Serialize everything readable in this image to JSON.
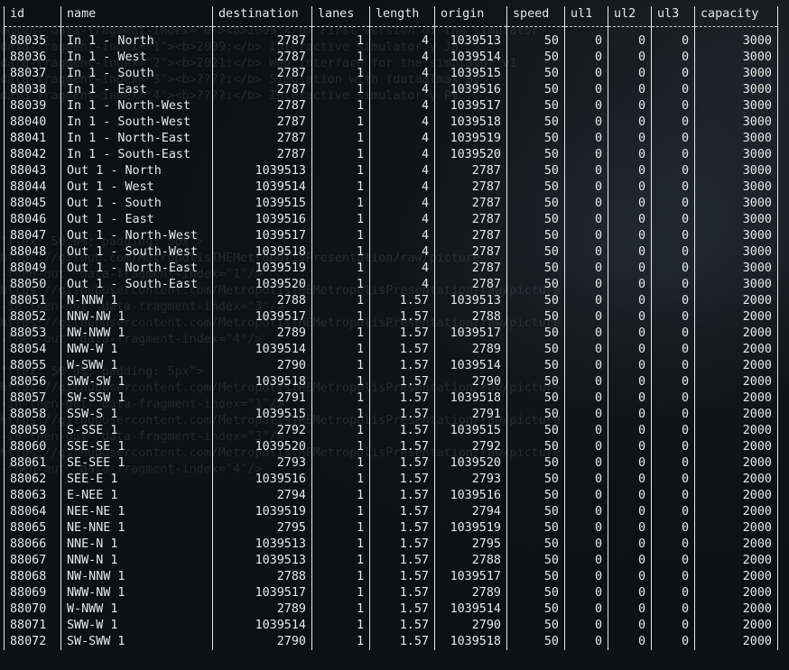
{
  "ghost_lines": [
    "agment data-fragment-index=\"0\"><b>2009:</b> First version of the simulator",
    "data-fragment-index=\"1\"><b>2009:</b> Interactive simulator y Ja",
    "data-fragment-index=\"2\"><b>2021:</b> Web interface for the simulator v1",
    "data-fragment-index=\"3\"><b>????:</b> Simulation with (dataalmax av",
    "data-fragment-index=\"4\"><b>????:</b> Interactive simulator y Py",
    "",
    "",
    "",
    "",
    "",
    "",
    "",
    "",
    "\"flex: 50.0%; padding: 5px\">",
    "https://github.com/MetropolisTHEMetropolisPresentation/raw/picture",
    "-then-out\" data-fragment-index=\"1\"/>",
    "https://githubusercontent.com/MetropolisTHEMetropolisPresentation/raw/picture",
    "-in-then-out\" data-fragment-index=\"3\"/>",
    "https://githubusercontent.com/MetropolisTHEMetropolisPresentation/raw/picture",
    "-then-out\" data-fragment-index=\"4\"/>",
    "",
    "\"flex: 50.0%; padding: 5px\">",
    "https://githubusercontent.com/MetropolisTHEMetropolisPresentation/raw/picture",
    "-in-then-out\" data-fragment-index=\"1\"/>",
    "https://githubusercontent.com/MetropolisTHEMetropolisPresentation/raw/picture",
    "-in-then-out\" data-fragment-index=\"3\"/>",
    "https://githubusercontent.com/MetropolisTHEMetropolisPresentation/raw/picture",
    "-then-out\" data-fragment-index=\"4\"/>"
  ],
  "table": {
    "columns": [
      "id",
      "name",
      "destination",
      "lanes",
      "length",
      "origin",
      "speed",
      "ul1",
      "ul2",
      "ul3",
      "capacity"
    ],
    "rows": [
      [
        "88035",
        "In 1 - North",
        "2787",
        "1",
        "4",
        "1039513",
        "50",
        "0",
        "0",
        "0",
        "3000"
      ],
      [
        "88036",
        "In 1 - West",
        "2787",
        "1",
        "4",
        "1039514",
        "50",
        "0",
        "0",
        "0",
        "3000"
      ],
      [
        "88037",
        "In 1 - South",
        "2787",
        "1",
        "4",
        "1039515",
        "50",
        "0",
        "0",
        "0",
        "3000"
      ],
      [
        "88038",
        "In 1 - East",
        "2787",
        "1",
        "4",
        "1039516",
        "50",
        "0",
        "0",
        "0",
        "3000"
      ],
      [
        "88039",
        "In 1 - North-West",
        "2787",
        "1",
        "4",
        "1039517",
        "50",
        "0",
        "0",
        "0",
        "3000"
      ],
      [
        "88040",
        "In 1 - South-West",
        "2787",
        "1",
        "4",
        "1039518",
        "50",
        "0",
        "0",
        "0",
        "3000"
      ],
      [
        "88041",
        "In 1 - North-East",
        "2787",
        "1",
        "4",
        "1039519",
        "50",
        "0",
        "0",
        "0",
        "3000"
      ],
      [
        "88042",
        "In 1 - South-East",
        "2787",
        "1",
        "4",
        "1039520",
        "50",
        "0",
        "0",
        "0",
        "3000"
      ],
      [
        "88043",
        "Out 1 - North",
        "1039513",
        "1",
        "4",
        "2787",
        "50",
        "0",
        "0",
        "0",
        "3000"
      ],
      [
        "88044",
        "Out 1 - West",
        "1039514",
        "1",
        "4",
        "2787",
        "50",
        "0",
        "0",
        "0",
        "3000"
      ],
      [
        "88045",
        "Out 1 - South",
        "1039515",
        "1",
        "4",
        "2787",
        "50",
        "0",
        "0",
        "0",
        "3000"
      ],
      [
        "88046",
        "Out 1 - East",
        "1039516",
        "1",
        "4",
        "2787",
        "50",
        "0",
        "0",
        "0",
        "3000"
      ],
      [
        "88047",
        "Out 1 - North-West",
        "1039517",
        "1",
        "4",
        "2787",
        "50",
        "0",
        "0",
        "0",
        "3000"
      ],
      [
        "88048",
        "Out 1 - South-West",
        "1039518",
        "1",
        "4",
        "2787",
        "50",
        "0",
        "0",
        "0",
        "3000"
      ],
      [
        "88049",
        "Out 1 - North-East",
        "1039519",
        "1",
        "4",
        "2787",
        "50",
        "0",
        "0",
        "0",
        "3000"
      ],
      [
        "88050",
        "Out 1 - South-East",
        "1039520",
        "1",
        "4",
        "2787",
        "50",
        "0",
        "0",
        "0",
        "3000"
      ],
      [
        "88051",
        "N-NNW 1",
        "2788",
        "1",
        "1.57",
        "1039513",
        "50",
        "0",
        "0",
        "0",
        "2000"
      ],
      [
        "88052",
        "NNW-NW 1",
        "1039517",
        "1",
        "1.57",
        "2788",
        "50",
        "0",
        "0",
        "0",
        "2000"
      ],
      [
        "88053",
        "NW-NWW 1",
        "2789",
        "1",
        "1.57",
        "1039517",
        "50",
        "0",
        "0",
        "0",
        "2000"
      ],
      [
        "88054",
        "NWW-W 1",
        "1039514",
        "1",
        "1.57",
        "2789",
        "50",
        "0",
        "0",
        "0",
        "2000"
      ],
      [
        "88055",
        "W-SWW 1",
        "2790",
        "1",
        "1.57",
        "1039514",
        "50",
        "0",
        "0",
        "0",
        "2000"
      ],
      [
        "88056",
        "SWW-SW 1",
        "1039518",
        "1",
        "1.57",
        "2790",
        "50",
        "0",
        "0",
        "0",
        "2000"
      ],
      [
        "88057",
        "SW-SSW 1",
        "2791",
        "1",
        "1.57",
        "1039518",
        "50",
        "0",
        "0",
        "0",
        "2000"
      ],
      [
        "88058",
        "SSW-S 1",
        "1039515",
        "1",
        "1.57",
        "2791",
        "50",
        "0",
        "0",
        "0",
        "2000"
      ],
      [
        "88059",
        "S-SSE 1",
        "2792",
        "1",
        "1.57",
        "1039515",
        "50",
        "0",
        "0",
        "0",
        "2000"
      ],
      [
        "88060",
        "SSE-SE 1",
        "1039520",
        "1",
        "1.57",
        "2792",
        "50",
        "0",
        "0",
        "0",
        "2000"
      ],
      [
        "88061",
        "SE-SEE 1",
        "2793",
        "1",
        "1.57",
        "1039520",
        "50",
        "0",
        "0",
        "0",
        "2000"
      ],
      [
        "88062",
        "SEE-E 1",
        "1039516",
        "1",
        "1.57",
        "2793",
        "50",
        "0",
        "0",
        "0",
        "2000"
      ],
      [
        "88063",
        "E-NEE 1",
        "2794",
        "1",
        "1.57",
        "1039516",
        "50",
        "0",
        "0",
        "0",
        "2000"
      ],
      [
        "88064",
        "NEE-NE 1",
        "1039519",
        "1",
        "1.57",
        "2794",
        "50",
        "0",
        "0",
        "0",
        "2000"
      ],
      [
        "88065",
        "NE-NNE 1",
        "2795",
        "1",
        "1.57",
        "1039519",
        "50",
        "0",
        "0",
        "0",
        "2000"
      ],
      [
        "88066",
        "NNE-N 1",
        "1039513",
        "1",
        "1.57",
        "2795",
        "50",
        "0",
        "0",
        "0",
        "2000"
      ],
      [
        "88067",
        "NNW-N 1",
        "1039513",
        "1",
        "1.57",
        "2788",
        "50",
        "0",
        "0",
        "0",
        "2000"
      ],
      [
        "88068",
        "NW-NNW 1",
        "2788",
        "1",
        "1.57",
        "1039517",
        "50",
        "0",
        "0",
        "0",
        "2000"
      ],
      [
        "88069",
        "NWW-NW 1",
        "1039517",
        "1",
        "1.57",
        "2789",
        "50",
        "0",
        "0",
        "0",
        "2000"
      ],
      [
        "88070",
        "W-NWW 1",
        "2789",
        "1",
        "1.57",
        "1039514",
        "50",
        "0",
        "0",
        "0",
        "2000"
      ],
      [
        "88071",
        "SWW-W 1",
        "1039514",
        "1",
        "1.57",
        "2790",
        "50",
        "0",
        "0",
        "0",
        "2000"
      ],
      [
        "88072",
        "SW-SWW 1",
        "2790",
        "1",
        "1.57",
        "1039518",
        "50",
        "0",
        "0",
        "0",
        "2000"
      ]
    ]
  }
}
